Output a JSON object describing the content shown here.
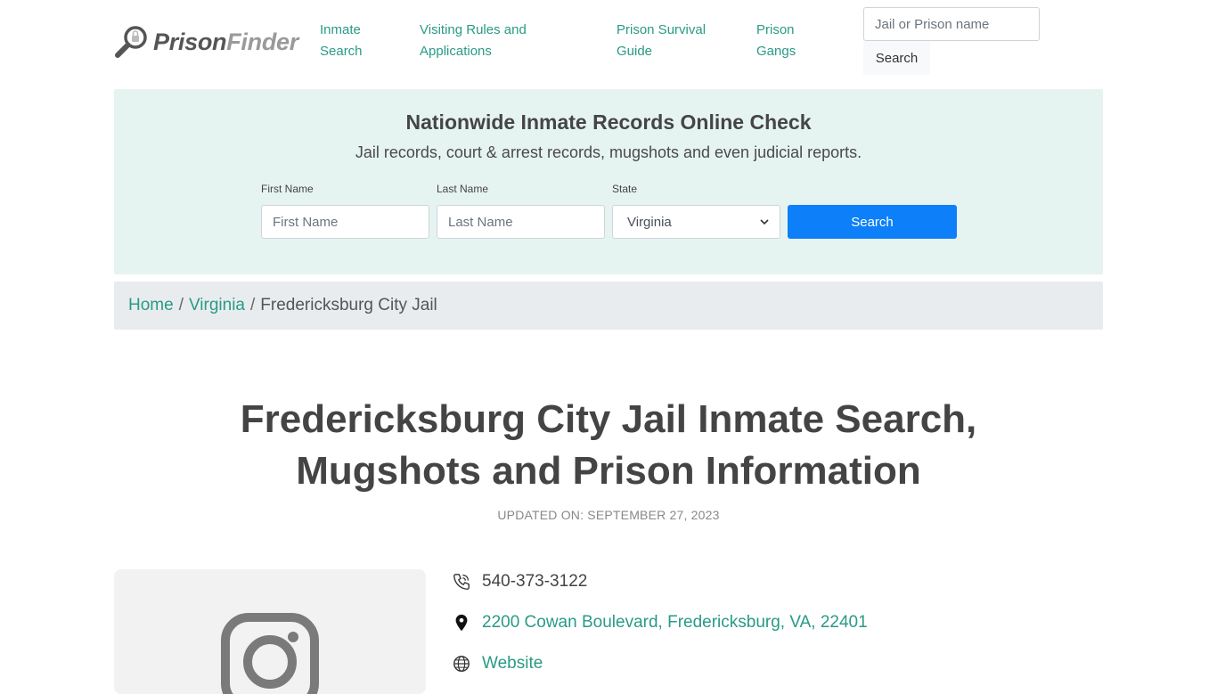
{
  "header": {
    "logo": {
      "part1": "Prison",
      "part2": "Finder"
    },
    "nav": [
      {
        "line1": "Inmate",
        "line2": "Search"
      },
      {
        "line1": "Visiting Rules and",
        "line2": "Applications"
      },
      {
        "line1": "Prison Survival",
        "line2": "Guide"
      },
      {
        "line1": "Prison",
        "line2": "Gangs"
      }
    ],
    "search_placeholder": "Jail or Prison name",
    "search_button": "Search"
  },
  "banner": {
    "title": "Nationwide Inmate Records Online Check",
    "subtitle": "Jail records, court & arrest records, mugshots and even judicial reports.",
    "first_name_label": "First Name",
    "first_name_placeholder": "First Name",
    "last_name_label": "Last Name",
    "last_name_placeholder": "Last Name",
    "state_label": "State",
    "state_value": "Virginia",
    "search_button": "Search"
  },
  "breadcrumb": {
    "home": "Home",
    "state": "Virginia",
    "current": "Fredericksburg City Jail",
    "separator": "/"
  },
  "page": {
    "title_line1": "Fredericksburg City Jail Inmate Search,",
    "title_line2": "Mugshots and Prison Information",
    "updated": "UPDATED ON: SEPTEMBER 27, 2023"
  },
  "info": {
    "phone": "540-373-3122",
    "address": "2200 Cowan Boulevard, Fredericksburg, VA, 22401",
    "website": "Website"
  },
  "colors": {
    "link": "#2a9a86",
    "banner_bg": "#e6f4f1",
    "primary_button": "#0d7ff8",
    "breadcrumb_bg": "#e9ecef"
  }
}
